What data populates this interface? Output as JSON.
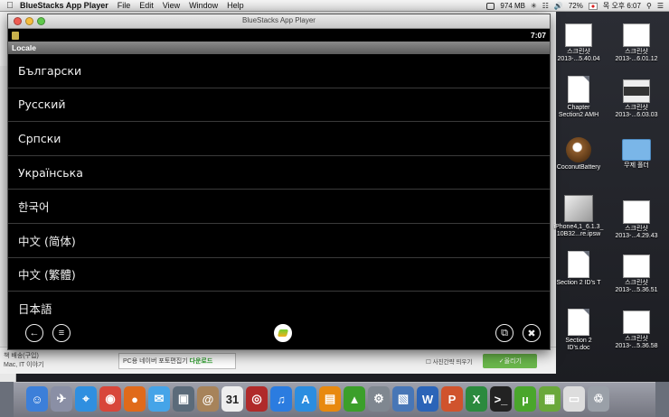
{
  "menubar": {
    "apple_icon": "apple-icon",
    "app_name": "BlueStacks App Player",
    "menus": [
      "File",
      "Edit",
      "View",
      "Window",
      "Help"
    ],
    "memory": "974 MB",
    "battery": "72%",
    "clock": "목 오후 6:07"
  },
  "window": {
    "title": "BlueStacks App Player"
  },
  "android": {
    "status_time": "7:07",
    "header": "Locale",
    "locales": [
      "Български",
      "Русский",
      "Српски",
      "Українська",
      "한국어",
      "中文 (简体)",
      "中文 (繁體)",
      "日本語"
    ],
    "nav_icons": [
      "back-icon",
      "menu-icon",
      "bluestacks-home-icon",
      "window-icon",
      "tools-icon"
    ]
  },
  "behind": {
    "left_items": [
      "책 배송(구입)",
      "Mac, IT 이야기"
    ],
    "ad_text_prefix": "PC용 네이버 포토편집기",
    "ad_link": "다운로드",
    "checkbox_label": "사진간략 띄우기",
    "download_button": "올리기"
  },
  "desktop_icons": [
    {
      "line1": "스크린샷",
      "line2": "2013-...5.40.04",
      "kind": "thumb"
    },
    {
      "line1": "스크린샷",
      "line2": "2013-...6.01.12",
      "kind": "thumb"
    },
    {
      "line1": "Chapter",
      "line2": "Section2 AMH",
      "kind": "doc"
    },
    {
      "line1": "스크린샷",
      "line2": "2013-...6.03.03",
      "kind": "thumb-dark"
    },
    {
      "line1": "CoconutBattery",
      "line2": "",
      "kind": "coconut"
    },
    {
      "line1": "무제 폴더",
      "line2": "",
      "kind": "folder"
    },
    {
      "line1": "iPhone4,1_6.1.3_",
      "line2": "10B32...re.ipsw",
      "kind": "box"
    },
    {
      "line1": "스크린샷",
      "line2": "2013-...4.29.43",
      "kind": "thumb"
    },
    {
      "line1": "Section 2 ID's T",
      "line2": "",
      "kind": "doc"
    },
    {
      "line1": "스크린샷",
      "line2": "2013-...5.36.51",
      "kind": "thumb"
    },
    {
      "line1": "Section 2",
      "line2": "ID's.doc",
      "kind": "doc"
    },
    {
      "line1": "스크린샷",
      "line2": "2013-...5.36.58",
      "kind": "thumb"
    }
  ],
  "dock": {
    "calendar_day": "31",
    "apps": [
      {
        "name": "finder-icon",
        "color": "#3c7fd9"
      },
      {
        "name": "launchpad-icon",
        "color": "#8a8fa5"
      },
      {
        "name": "safari-icon",
        "color": "#2f8fe0"
      },
      {
        "name": "chrome-icon",
        "color": "#d8463a"
      },
      {
        "name": "firefox-icon",
        "color": "#e06a1a"
      },
      {
        "name": "messages-icon",
        "color": "#45a4e8"
      },
      {
        "name": "photos-icon",
        "color": "#5b6b7a"
      },
      {
        "name": "contacts-icon",
        "color": "#a7835a"
      },
      {
        "name": "calendar-icon",
        "color": "#eeeeee"
      },
      {
        "name": "photo-booth-icon",
        "color": "#b02a2a"
      },
      {
        "name": "itunes-icon",
        "color": "#2b7ce0"
      },
      {
        "name": "app-store-icon",
        "color": "#2b8de0"
      },
      {
        "name": "ibooks-icon",
        "color": "#e8890e"
      },
      {
        "name": "bluestacks-icon",
        "color": "#3b9f2a"
      },
      {
        "name": "system-preferences-icon",
        "color": "#7f8790"
      },
      {
        "name": "preview-icon",
        "color": "#4876b6"
      },
      {
        "name": "word-icon",
        "color": "#2b64b8"
      },
      {
        "name": "powerpoint-icon",
        "color": "#d0532d"
      },
      {
        "name": "excel-icon",
        "color": "#2b8a3e"
      },
      {
        "name": "terminal-icon",
        "color": "#222222"
      },
      {
        "name": "utorrent-icon",
        "color": "#4aa62c"
      },
      {
        "name": "bluestacks-apps-icon",
        "color": "#6aa83a"
      },
      {
        "name": "document-icon",
        "color": "#dddddd"
      },
      {
        "name": "trash-icon",
        "color": "#9aa0a8"
      }
    ]
  }
}
